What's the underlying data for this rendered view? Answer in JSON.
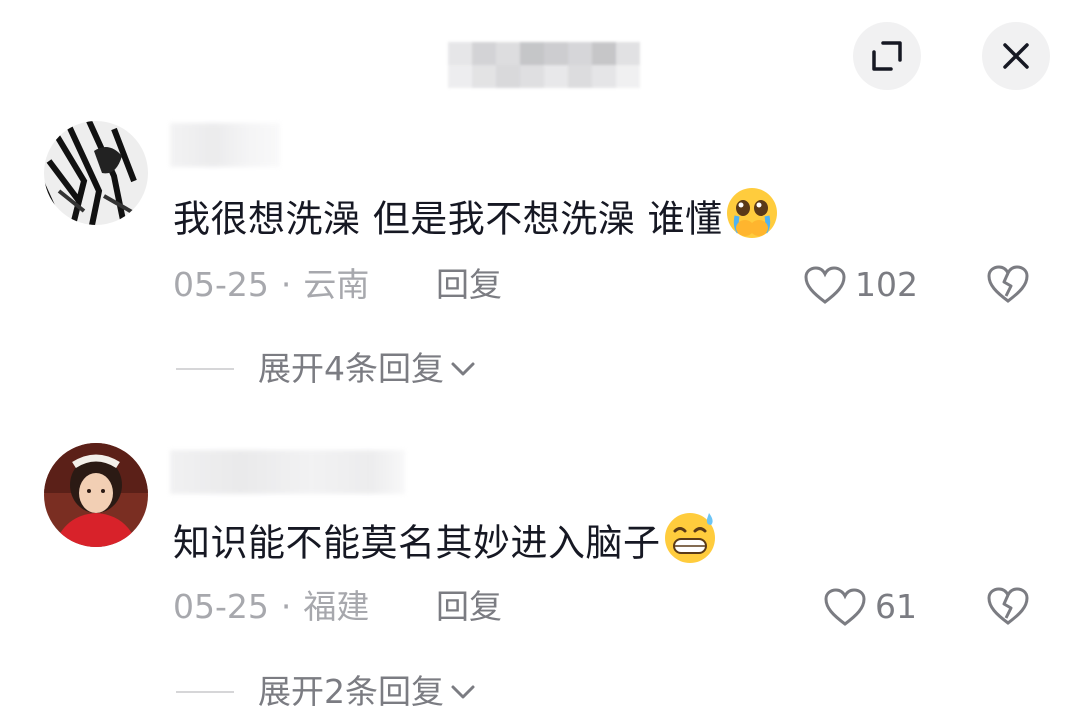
{
  "header": {
    "maximize_icon": "expand-icon",
    "close_icon": "close-icon"
  },
  "comments": [
    {
      "text": "我很想洗澡 但是我不想洗澡 谁懂",
      "emoji": "pleading-crying-emoji",
      "date": "05-25",
      "location": "云南",
      "reply_label": "回复",
      "likes": "102",
      "expand_label": "展开4条回复"
    },
    {
      "text": "知识能不能莫名其妙进入脑子",
      "emoji": "grinning-sweat-emoji",
      "date": "05-25",
      "location": "福建",
      "reply_label": "回复",
      "likes": "61",
      "expand_label": "展开2条回复"
    }
  ],
  "colors": {
    "text_primary": "#161823",
    "text_secondary": "#a7a8ad",
    "text_muted": "#7b7c82",
    "button_bg": "#f1f1f2"
  }
}
